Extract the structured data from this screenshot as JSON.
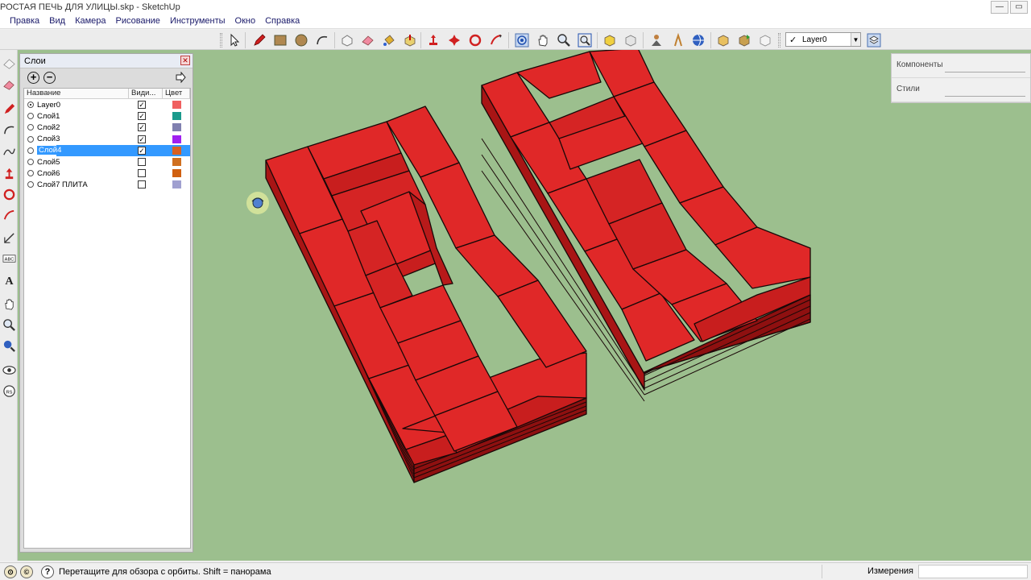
{
  "window": {
    "title": "РОСТАЯ ПЕЧЬ ДЛЯ УЛИЦЫ.skp - SketchUp",
    "minimize": "—",
    "maximize": "▭"
  },
  "menu": [
    "Правка",
    "Вид",
    "Камера",
    "Рисование",
    "Инструменты",
    "Окно",
    "Справка"
  ],
  "toolbar": {
    "layer_current": "Layer0",
    "layer_check": "✓",
    "tools": [
      "select-icon",
      "pencil-icon",
      "rectangle-icon",
      "circle-icon",
      "arc-icon",
      "make-component-icon",
      "eraser-icon",
      "paint-bucket-icon",
      "push-pull-icon",
      "move-icon",
      "rotate-icon",
      "offset-icon",
      "orbit-icon",
      "pan-icon",
      "zoom-icon",
      "zoom-extents-icon",
      "previous-view-icon",
      "next-view-icon",
      "position-camera-icon",
      "walk-icon",
      "look-around-icon",
      "get-models-icon",
      "share-model-icon",
      "share-component-icon",
      "extension-icon",
      "layers-manager-icon"
    ]
  },
  "left_tools": [
    "eraser-icon",
    "paint-icon",
    "pencil-icon",
    "arc-icon",
    "push-pull-icon",
    "follow-me-icon",
    "offset-icon",
    "tape-measure-icon",
    "dimension-icon",
    "text-icon",
    "axes-icon",
    "3d-text-icon",
    "pan-icon",
    "zoom-icon",
    "position-camera-icon",
    "look-around-icon",
    "section-plane-icon"
  ],
  "layers_panel": {
    "title": "Слои",
    "close": "✕",
    "add": "+",
    "remove": "−",
    "columns": {
      "name": "Название",
      "visible": "Види...",
      "color": "Цвет"
    },
    "rows": [
      {
        "name": "Layer0",
        "active": true,
        "visible": true,
        "color": "#f06060",
        "selected": false
      },
      {
        "name": "Слой1",
        "active": false,
        "visible": true,
        "color": "#1a9a8c",
        "selected": false
      },
      {
        "name": "Слой2",
        "active": false,
        "visible": true,
        "color": "#8080b0",
        "selected": false
      },
      {
        "name": "Слой3",
        "active": false,
        "visible": true,
        "color": "#a020f0",
        "selected": false
      },
      {
        "name": "Слой4",
        "active": false,
        "visible": true,
        "color": "#d86020",
        "selected": true
      },
      {
        "name": "Слой5",
        "active": false,
        "visible": false,
        "color": "#d07020",
        "selected": false
      },
      {
        "name": "Слой6",
        "active": false,
        "visible": false,
        "color": "#d06010",
        "selected": false
      },
      {
        "name": "Слой7 ПЛИТА",
        "active": false,
        "visible": false,
        "color": "#a0a0d0",
        "selected": false
      }
    ],
    "check_mark": "✓"
  },
  "tray": {
    "components": "Компоненты",
    "styles": "Стили"
  },
  "status": {
    "help": "?",
    "message": "Перетащите для обзора с орбиты.  Shift = панорама",
    "measure_label": "Измерения",
    "measure_value": ""
  },
  "colors": {
    "viewport_bg": "#9cbf8e",
    "brick_top": "#e32a2a",
    "brick_side": "#b91818",
    "brick_dark": "#8a0e0e",
    "mortar": "#1a0a0a"
  }
}
